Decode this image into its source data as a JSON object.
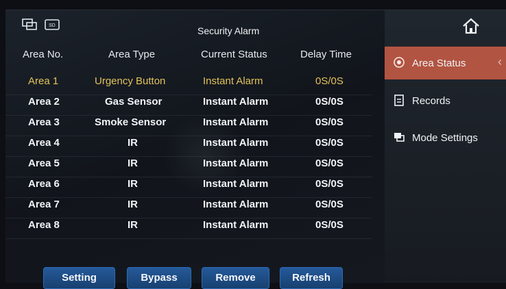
{
  "header": {
    "title": "Security Alarm"
  },
  "columns": [
    "Area No.",
    "Area Type",
    "Current Status",
    "Delay Time"
  ],
  "rows": [
    {
      "area": "Area 1",
      "type": "Urgency Button",
      "status": "Instant Alarm",
      "delay": "0S/0S",
      "selected": true
    },
    {
      "area": "Area 2",
      "type": "Gas Sensor",
      "status": "Instant Alarm",
      "delay": "0S/0S"
    },
    {
      "area": "Area 3",
      "type": "Smoke Sensor",
      "status": "Instant Alarm",
      "delay": "0S/0S"
    },
    {
      "area": "Area 4",
      "type": "IR",
      "status": "Instant Alarm",
      "delay": "0S/0S"
    },
    {
      "area": "Area 5",
      "type": "IR",
      "status": "Instant Alarm",
      "delay": "0S/0S"
    },
    {
      "area": "Area 6",
      "type": "IR",
      "status": "Instant Alarm",
      "delay": "0S/0S"
    },
    {
      "area": "Area 7",
      "type": "IR",
      "status": "Instant Alarm",
      "delay": "0S/0S"
    },
    {
      "area": "Area 8",
      "type": "IR",
      "status": "Instant Alarm",
      "delay": "0S/0S"
    }
  ],
  "sidebar": {
    "items": [
      {
        "label": "Area Status",
        "icon": "area-status-icon",
        "active": true
      },
      {
        "label": "Records",
        "icon": "records-icon"
      },
      {
        "label": "Mode Settings",
        "icon": "mode-settings-icon"
      }
    ]
  },
  "buttons": [
    "Setting",
    "Bypass",
    "Remove",
    "Refresh"
  ],
  "colors": {
    "accent": "#b25442",
    "selected_text": "#e2c25a",
    "button_blue": "#1f4f88"
  }
}
